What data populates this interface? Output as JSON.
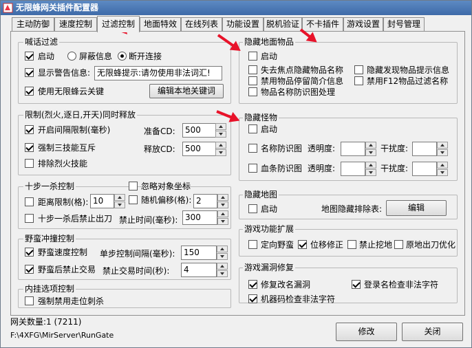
{
  "window": {
    "title": "无限蜂网关插件配置器"
  },
  "tabs": [
    "主动防御",
    "速度控制",
    "过滤控制",
    "地面特效",
    "在线列表",
    "功能设置",
    "脱机验证",
    "不卡插件",
    "游戏设置",
    "封号管理"
  ],
  "shout_filter": {
    "title": "喊话过滤",
    "enable": "启动",
    "block_info": "屏蔽信息",
    "disconnect": "断开连接",
    "show_warning": "显示警告信息:",
    "warning_value": "无限蜂提示:请勿使用非法词汇!",
    "use_cloud": "使用无限蜂云关键",
    "edit_btn": "编辑本地关键词"
  },
  "limit_release": {
    "title": "限制(烈火,逐日,开天)同时释放",
    "interval_limit": "开启间隔限制(毫秒)",
    "prepare_cd": "准备CD:",
    "prepare_value": "500",
    "mutex": "强制三技能互斥",
    "release_cd": "释放CD:",
    "release_value": "500",
    "exclude_fire": "排除烈火技能"
  },
  "ten_step": {
    "title": "十步一杀控制",
    "ignore_coord": "忽略对象坐标",
    "distance": "距离限制(格):",
    "distance_value": "10",
    "random_offset": "随机偏移(格):",
    "random_value": "2",
    "forbid_exit": "十步一杀后禁止出刀",
    "forbid_time": "禁止时间(毫秒):",
    "forbid_value": "300"
  },
  "charge": {
    "title": "野蛮冲撞控制",
    "speed": "野蛮速度控制",
    "step_interval": "单步控制间隔(毫秒):",
    "step_value": "150",
    "forbid_trade": "野蛮后禁止交易",
    "trade_time": "禁止交易时间(秒):",
    "trade_value": "4"
  },
  "inner": {
    "title": "内挂选项控制",
    "force_disable": "强制禁用走位刺杀"
  },
  "hide_ground": {
    "title": "隐藏地面物品",
    "enable": "启动",
    "lose_focus": "失去焦点隐藏物品名称",
    "hide_found": "隐藏发现物品提示信息",
    "disable_stay": "禁用物品停留简介信息",
    "disable_f12": "禁用F12物品过滤名称",
    "anti_name": "物品名称防识图处理"
  },
  "hide_monster": {
    "title": "隐藏怪物",
    "enable": "启动",
    "name_anti": "名称防识图",
    "transparency": "透明度:",
    "interference": "干扰度:",
    "hp_anti": "血条防识图",
    "transparency2": "透明度:",
    "interference2": "干扰度:"
  },
  "hide_map": {
    "title": "隐藏地图",
    "enable": "启动",
    "exclude": "地图隐藏排除表:",
    "edit_btn": "编辑"
  },
  "game_ext": {
    "title": "游戏功能扩展",
    "fixed_dir": "定向野蛮",
    "pos_fix": "位移修正",
    "forbid_dig": "禁止挖地",
    "stand_opt": "原地出刀优化"
  },
  "game_fix": {
    "title": "游戏漏洞修复",
    "fix_rename": "修复改名漏洞",
    "login_check": "登录名检查非法字符",
    "bot_check": "机器码检查非法字符"
  },
  "status": {
    "gateway_count": "网关数量:1 (7211)",
    "path": "F:\\4XFG\\MirServer\\RunGate"
  },
  "buttons": {
    "modify": "修改",
    "close": "关闭"
  }
}
